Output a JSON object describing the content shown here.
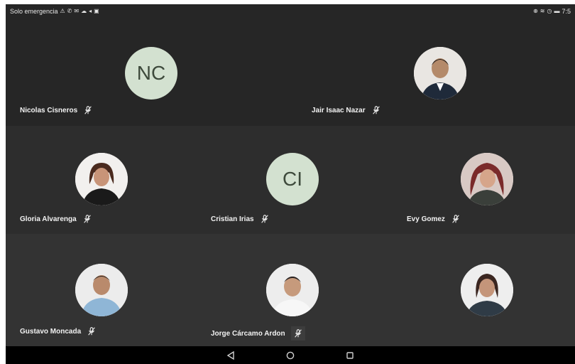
{
  "statusbar": {
    "left_text": "Solo emergencia",
    "time": "7:5",
    "left_icons": [
      "warning-icon",
      "phone-icon",
      "mail-icon",
      "cloud-icon",
      "signal-icon",
      "message-icon"
    ],
    "right_icons": [
      "vibrate-icon",
      "wifi-icon",
      "alarm-icon",
      "battery-icon"
    ]
  },
  "participants": [
    {
      "name": "Nicolas Cisneros",
      "initials": "NC",
      "avatar_type": "initials",
      "muted": true
    },
    {
      "name": "Jair Isaac Nazar",
      "initials": "",
      "avatar_type": "photo",
      "muted": true
    },
    {
      "name": "Gloria Alvarenga",
      "initials": "",
      "avatar_type": "photo",
      "muted": true
    },
    {
      "name": "Cristian Irias",
      "initials": "CI",
      "avatar_type": "initials",
      "muted": true
    },
    {
      "name": "Evy Gomez",
      "initials": "",
      "avatar_type": "photo",
      "muted": true
    },
    {
      "name": "Gustavo Moncada",
      "initials": "",
      "avatar_type": "photo",
      "muted": true
    },
    {
      "name": "Jorge Cárcamo Ardon",
      "initials": "",
      "avatar_type": "photo",
      "muted": true
    },
    {
      "name": "",
      "initials": "",
      "avatar_type": "photo",
      "muted": false
    }
  ],
  "navbar": {
    "buttons": [
      "back-icon",
      "home-icon",
      "recents-icon"
    ]
  },
  "colors": {
    "tile_dark": "#262626",
    "tile_mid": "#2d2d2d",
    "tile_light": "#333333",
    "initials_bg": "#d3e1d0",
    "initials_text": "#3e4a3c"
  }
}
